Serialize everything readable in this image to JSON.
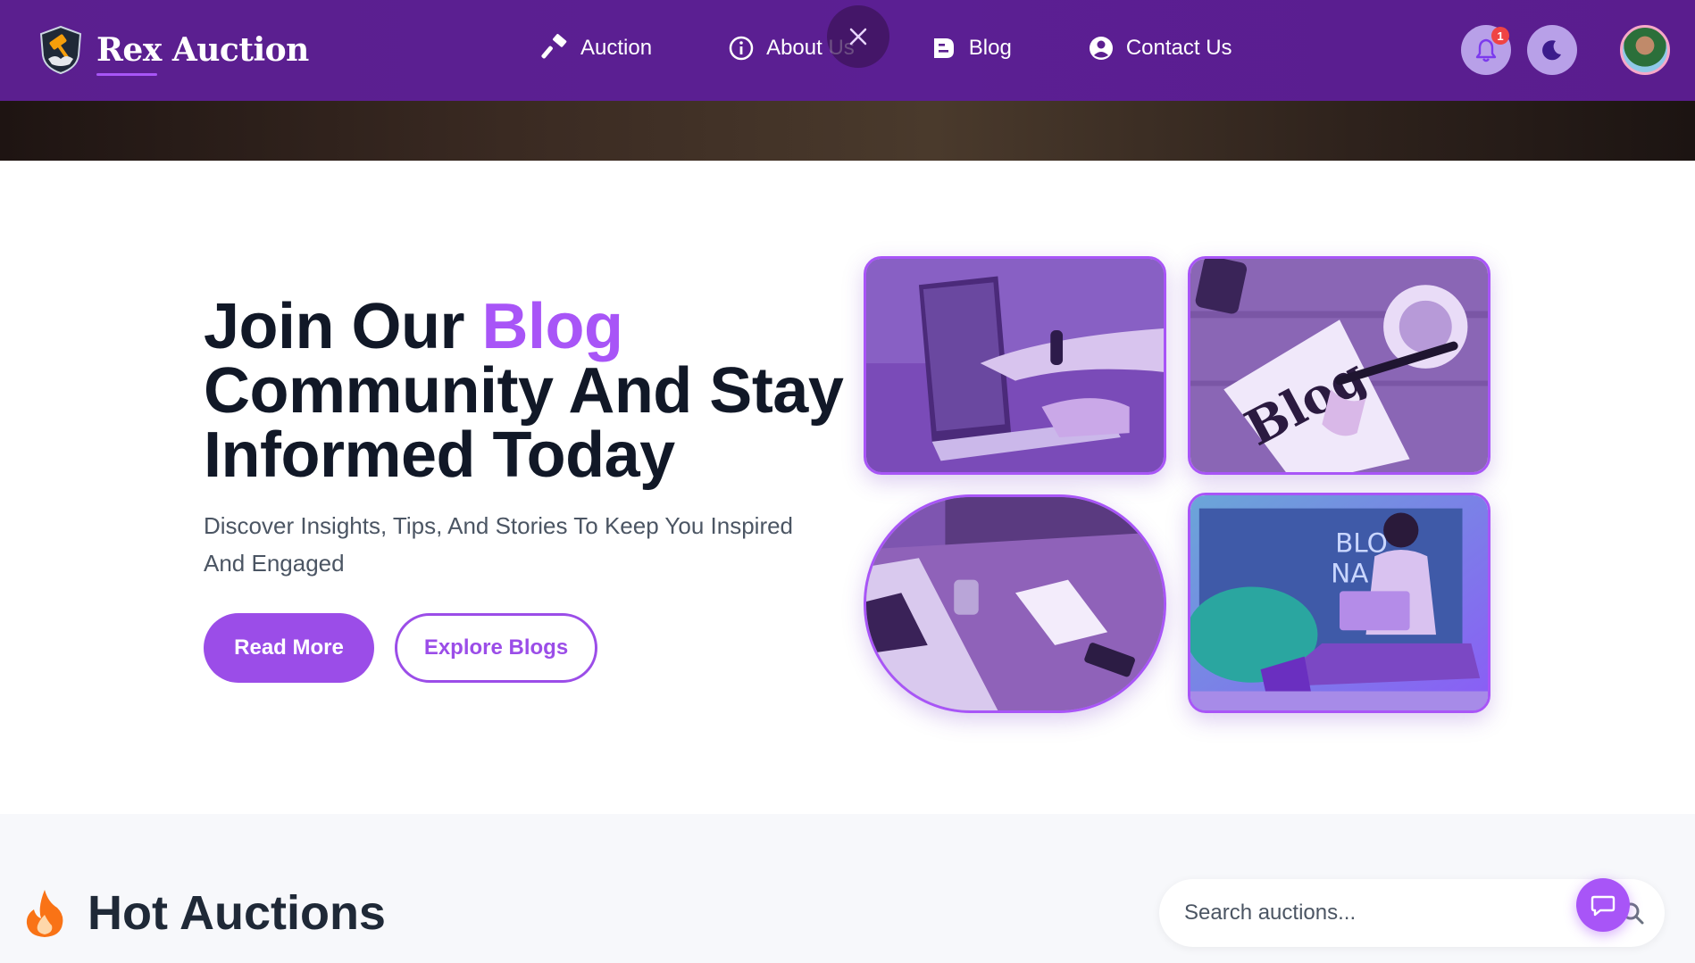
{
  "navbar": {
    "brand": "Rex Auction",
    "logo_icon": "gavel-shield-logo",
    "links": [
      {
        "label": "Auction",
        "icon": "hammer-icon"
      },
      {
        "label": "About Us",
        "icon": "info-icon"
      },
      {
        "label": "Blog",
        "icon": "blog-icon"
      },
      {
        "label": "Contact Us",
        "icon": "user-circle-icon"
      }
    ],
    "notification_count": "1",
    "icons": {
      "notifications": "bell-icon",
      "theme": "moon-icon",
      "close": "close-icon"
    }
  },
  "blog_hero": {
    "title_part1": "Join Our ",
    "title_accent": "Blog",
    "title_part2": "Community And Stay Informed Today",
    "subtitle": "Discover Insights, Tips, And Stories To Keep You Inspired And Engaged",
    "primary_button": "Read More",
    "secondary_button": "Explore Blogs",
    "tiles": [
      "laptop-pointing-image",
      "blog-notepad-image",
      "desk-laptop-image",
      "blog-name-collage-image"
    ]
  },
  "hot_auctions": {
    "title": "Hot Auctions",
    "title_icon": "fire-icon",
    "search": {
      "placeholder": "Search auctions..."
    }
  },
  "chat": {
    "icon": "chat-icon"
  },
  "colors": {
    "nav_bg": "#5b1f8f",
    "accent": "#a855f7",
    "button": "#9b4de8",
    "badge": "#ef4444",
    "flame": "#f97316"
  }
}
